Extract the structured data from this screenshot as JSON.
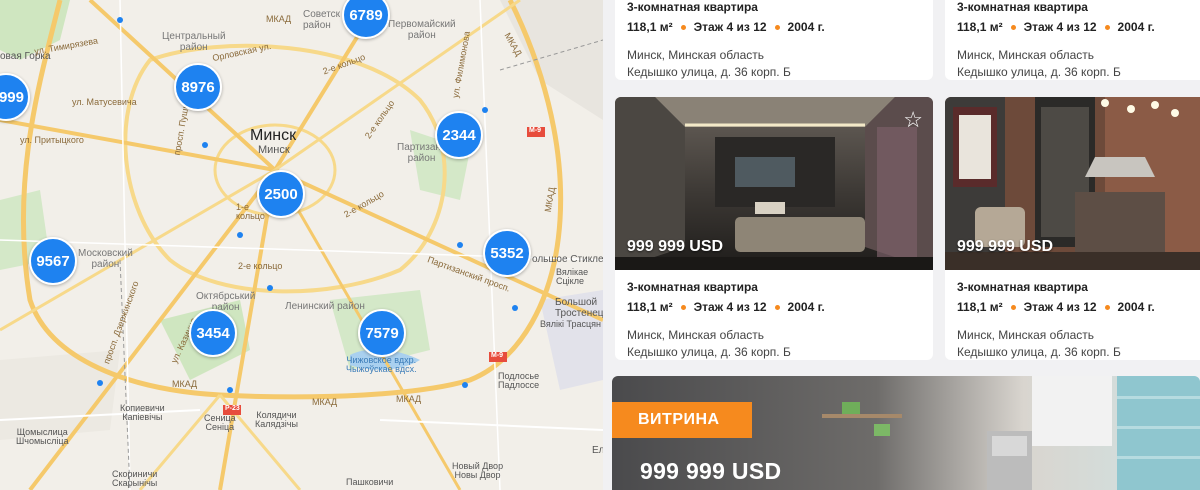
{
  "map": {
    "city_label": "Минск",
    "city_sub": "Минск",
    "clusters": [
      {
        "id": "6789",
        "count": "6789"
      },
      {
        "id": "8976",
        "count": "8976"
      },
      {
        "id": "999",
        "count": "999"
      },
      {
        "id": "2344",
        "count": "2344"
      },
      {
        "id": "2500",
        "count": "2500"
      },
      {
        "id": "9567",
        "count": "9567"
      },
      {
        "id": "5352",
        "count": "5352"
      },
      {
        "id": "3454",
        "count": "3454"
      },
      {
        "id": "7579",
        "count": "7579"
      }
    ],
    "labels": {
      "sovetsky": "Советск\nрайон",
      "pervomaisky": "Первомайский\nрайон",
      "centralny": "Центральный\nрайон",
      "gorka": "овая Горка",
      "tsimiryazeva": "ул. Тимирязева",
      "orlovskaya": "Орловская ул.",
      "kolco2_top": "2-е кольцо",
      "filimonova": "ул. Филимонова",
      "matusevicha": "ул. Матусевича",
      "pushkina": "просп. Пушкина",
      "pritytskogo": "ул. Притыцкого",
      "partizansky": "Партизанс\nрайон",
      "kolco2_right": "2-е кольцо",
      "kolco1": "1-е\nкольцо",
      "kolco2_mid": "2-е кольцо",
      "kolco2_low": "2-е кольцо",
      "moskovsky": "Московский\nрайон",
      "partiz_prosp": "Партизанский просп.",
      "bolshoe_stikl": "ольшое Стикле",
      "vyalikae": "Вялікае\nСцікле",
      "oktyabrsky": "Октябрський\nрайон",
      "leninsky": "Ленинский район",
      "bolshoy_trost": "Большой\nТростенец",
      "vyaliki_trost": "Вялікі Трасцян",
      "dzerzhinskogo": "просп. Дзержинского",
      "kazintsa": "ул. Казинца",
      "chizhovskoe": "Чижовское вдхр.\nЧыжоўскае вдсх.",
      "podlosye": "Подлосье\nПадлоссе",
      "mkad_top": "МКАД",
      "mkad_right": "МКАД",
      "mkad_right2": "МКАД",
      "mkad_bottom1": "МКАД",
      "mkad_bottom2": "МКАД",
      "mkad_bottom3": "МКАД",
      "kopievichi": "Копиевичи\nКапіевічы",
      "senica": "Сеница\nСеніца",
      "kolyadichi": "Колядичи\nКалядзічы",
      "shomyslitsa": "Щомыслица\nШчомысліца",
      "novy_dvor": "Новый Двор\nНовы Двор",
      "skorinichi": "Скориничи\nСкарынічы",
      "pashkovichi": "Пашковичи",
      "m9a": "М-9",
      "m9b": "М-9",
      "r23": "Р-23",
      "el": "Ел"
    }
  },
  "listings": [
    {
      "title": "3-комнатная квартира",
      "area": "118,1 м²",
      "floor": "Этаж 4 из 12",
      "year": "2004 г.",
      "region": "Минск, Минская область",
      "street": "Кедышко улица, д. 36 корп. Б"
    },
    {
      "title": "3-комнатная квартира",
      "area": "118,1 м²",
      "floor": "Этаж 4 из 12",
      "year": "2004 г.",
      "region": "Минск, Минская область",
      "street": "Кедышко улица, д. 36 корп. Б"
    },
    {
      "title": "3-комнатная квартира",
      "area": "118,1 м²",
      "floor": "Этаж 4 из 12",
      "year": "2004 г.",
      "region": "Минск, Минская область",
      "street": "Кедышко улица, д. 36 корп. Б",
      "price": "999 999 USD",
      "favorite_icon": "star-outline"
    },
    {
      "title": "3-комнатная квартира",
      "area": "118,1 м²",
      "floor": "Этаж 4 из 12",
      "year": "2004 г.",
      "region": "Минск, Минская область",
      "street": "Кедышко улица, д. 36 корп. Б",
      "price": "999 999 USD"
    }
  ],
  "showcase": {
    "badge": "ВИТРИНА",
    "price": "999 999 USD"
  },
  "colors": {
    "cluster": "#1e82f0",
    "accent": "#f68a1e"
  }
}
